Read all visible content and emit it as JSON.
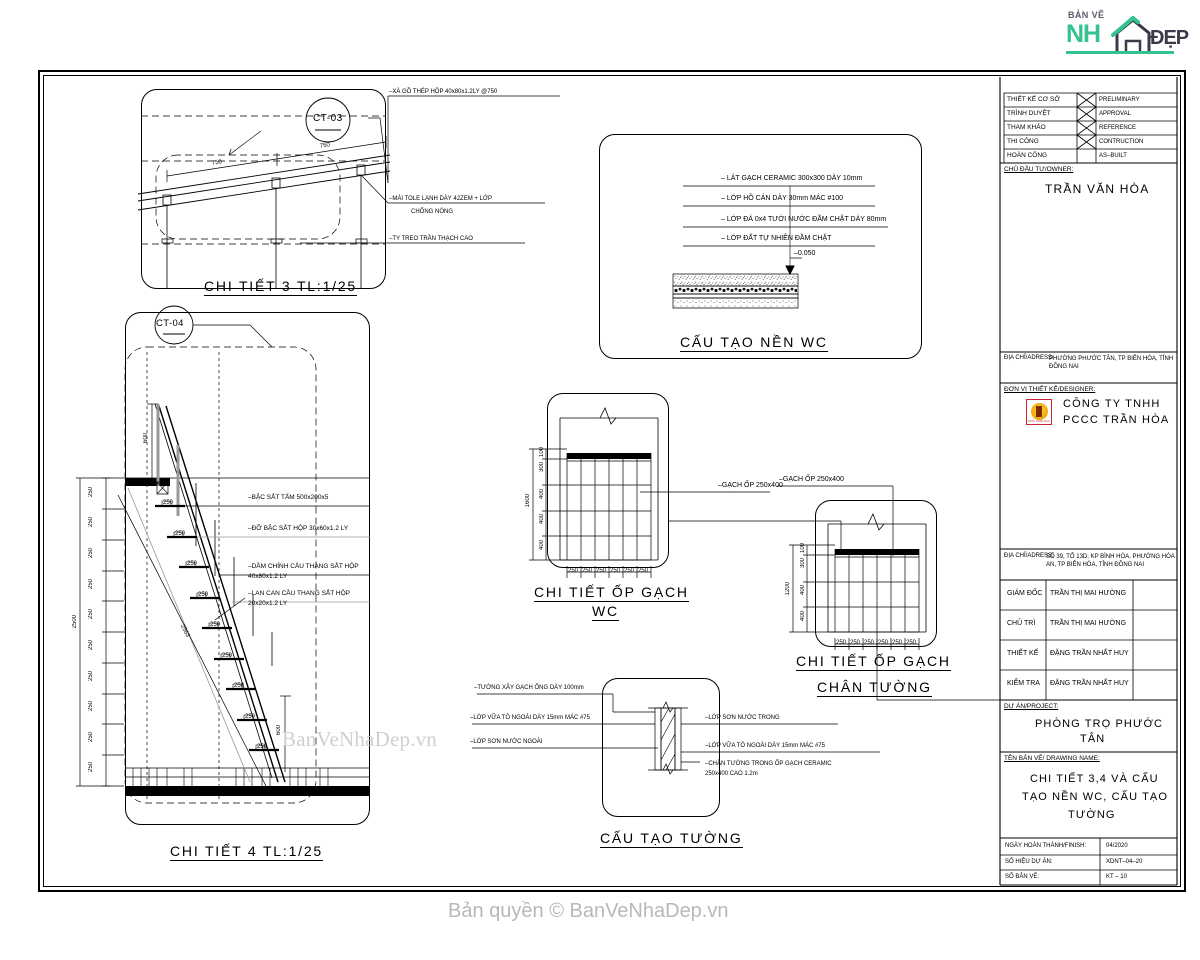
{
  "logo": {
    "top_text": "BẢN VẼ",
    "nh": "NH",
    "dep": "ĐẸP",
    "house_icon": "house-icon",
    "accent_color": "#34c38f"
  },
  "watermarks": {
    "center": "BanVeNhaDep.vn",
    "footer": "Bản quyền © BanVeNhaDep.vn"
  },
  "details": {
    "ct3": {
      "marker": "CT-03",
      "title": "CHI TIẾT 3  TL:1/25",
      "dims": [
        "750",
        "750"
      ],
      "notes": [
        "–XÀ GỒ THÉP HỘP 40x80x1.2LY @750",
        "–MÁI TOLE LẠNH DÀY 42ZEM + LỚP",
        "CHỐNG NÓNG",
        "–TY TREO TRẦN THẠCH CAO"
      ]
    },
    "ct4": {
      "marker": "CT-04",
      "title": "CHI TIẾT 4  TL:1/25",
      "total_dim": "2500",
      "riser_dims": [
        "250",
        "250",
        "250",
        "250",
        "250",
        "250",
        "250",
        "250",
        "250",
        "250"
      ],
      "top_dim": "600",
      "bottom_dim": "600",
      "slope_dim": "2563",
      "step_labels": [
        "250",
        "250",
        "250",
        "250",
        "250",
        "250",
        "250",
        "250",
        "250"
      ],
      "notes": [
        "–BẬC SẮT TẤM 500x200x5",
        "–ĐỠ BẬC SẮT HỘP 30x60x1.2 LY",
        "–DẦM CHÍNH CẦU THANG SẮT HỘP",
        "40x80x1.2 LY",
        "–LAN CAN CẦU THANG SẮT HỘP",
        "20x20x1.2 LY"
      ]
    },
    "wc_floor": {
      "title": "CẤU TẠO NỀN WC",
      "level": "–0.050",
      "layers": [
        "– LÁT GẠCH CERAMIC 300x300 DÀY 10mm",
        "– LỚP HỒ CÁN DÀY 30mm MÁC #100",
        "– LỚP ĐÁ 0x4 TƯỚI NƯỚC ĐẦM CHẶT DÀY 80mm",
        "– LỚP ĐẤT TỰ NHIÊN ĐẦM CHẶT"
      ]
    },
    "tile_wc": {
      "title_line1": "CHI TIẾT ỐP GẠCH",
      "title_line2": "WC",
      "note": "–GẠCH ỐP 250x400",
      "total_height": "1600",
      "v_dims": [
        "100",
        "300",
        "400",
        "400",
        "400"
      ],
      "h_dims": [
        "250",
        "250",
        "250",
        "250",
        "250",
        "250"
      ]
    },
    "tile_base": {
      "title_line1": "CHI TIẾT ỐP GẠCH",
      "title_line2": "CHÂN TƯỜNG",
      "note": "–GẠCH ỐP 250x400",
      "total_height": "1200",
      "v_dims": [
        "100",
        "300",
        "400",
        "400"
      ],
      "h_dims": [
        "250",
        "250",
        "250",
        "250",
        "250",
        "250"
      ]
    },
    "wall": {
      "title": "CẤU TẠO TƯỜNG",
      "notes_left": [
        "–TƯỜNG XÂY GẠCH ỐNG DÀY 100mm",
        "–LỚP VỮA TÔ NGOÀI DÀY 15mm MÁC #75",
        "–LỚP SƠN NƯỚC NGOÀI"
      ],
      "notes_right": [
        "–LỚP SƠN NƯỚC TRONG",
        "–LỚP VỮA TÔ NGOÀI DÀY 15mm MÁC #75",
        "–CHÂN TƯỜNG TRONG ỐP GẠCH CERAMIC",
        "250x400 CAO 1.2m"
      ]
    }
  },
  "title_block": {
    "stamp_rows": [
      {
        "vi": "THIẾT KẾ CƠ SỞ",
        "en": "PRELIMINARY",
        "checked": true
      },
      {
        "vi": "TRÌNH DUYỆT",
        "en": "APPROVAL",
        "checked": true
      },
      {
        "vi": "THAM KHẢO",
        "en": "REFERENCE",
        "checked": true
      },
      {
        "vi": "THI CÔNG",
        "en": "CONTRUCTION",
        "checked": true
      },
      {
        "vi": "HOÀN CÔNG",
        "en": "AS–BUILT",
        "checked": false
      }
    ],
    "owner_label": "CHỦ ĐẦU TƯ/OWNER:",
    "owner_name": "TRẦN VĂN HÒA",
    "owner_address_label": "ĐỊA CHỈ/ADRESS:",
    "owner_address": "PHƯỜNG PHƯỚC TÂN, TP BIÊN HÒA, TỈNH ĐỒNG NAI",
    "designer_label": "ĐƠN VỊ THIẾT KẾ/DESIGNER:",
    "designer_line1": "CÔNG TY TNHH",
    "designer_line2": "PCCC TRẦN HÒA",
    "designer_logo": "pccc-logo-icon",
    "designer_address_label": "ĐỊA CHỈ/ADRESS:",
    "designer_address": "SỐ 39, TỔ 13D, KP BÌNH HÓA, PHƯỜNG HÓA AN, TP BIÊN HÒA, TỈNH ĐỒNG NAI",
    "staff_rows": [
      {
        "role": "GIÁM ĐỐC",
        "name": "TRẦN THỊ MAI HƯỜNG"
      },
      {
        "role": "CHỦ TRÌ",
        "name": "TRẦN THỊ MAI HƯỜNG"
      },
      {
        "role": "THIẾT KẾ",
        "name": "ĐẶNG TRẦN NHẤT HUY"
      },
      {
        "role": "KIỂM TRA",
        "name": "ĐẶNG TRẦN NHẤT HUY"
      }
    ],
    "project_label": "DỰ ÁN/PROJECT:",
    "project_line1": "PHÒNG TRỌ PHƯỚC",
    "project_line2": "TÂN",
    "drawing_label": "TÊN BẢN VẼ/ DRAWING NAME:",
    "drawing_line1": "CHI TIẾT 3,4 VÀ CẤU",
    "drawing_line2": "TẠO NỀN WC, CẤU TẠO",
    "drawing_line3": "TƯỜNG",
    "footer_rows": [
      {
        "label": "NGÀY HOÀN THÀNH/FINISH:",
        "value": "04/2020"
      },
      {
        "label": "SỐ HIỆU DỰ ÁN:",
        "value": "XDNT–04–20"
      },
      {
        "label": "SỐ BẢN VẼ:",
        "value": "KT – 10"
      }
    ]
  }
}
